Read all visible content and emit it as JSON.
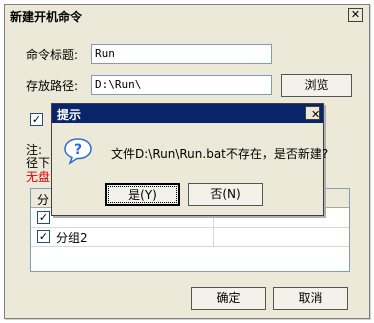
{
  "window": {
    "title": "新建开机命令"
  },
  "form": {
    "title_label": "命令标题:",
    "title_value": "Run",
    "path_label": "存放路径:",
    "path_value": "D:\\Run\\",
    "browse_label": "浏览",
    "note_visible_1": "注:",
    "note_visible_2": "径下",
    "warning_visible": "无盘"
  },
  "group_list": {
    "header_visible": "分",
    "rows": [
      {
        "label": "",
        "checked": true
      },
      {
        "label": "分组2",
        "checked": true
      }
    ]
  },
  "buttons": {
    "ok": "确定",
    "cancel": "取消"
  },
  "dialog": {
    "title": "提示",
    "message": "文件D:\\Run\\Run.bat不存在，是否新建?",
    "yes": "是(Y)",
    "no": "否(N)"
  },
  "icons": {
    "question": "question-icon",
    "close": "close-icon",
    "check": "checkmark-icon"
  },
  "colors": {
    "dialog_title_bg": "#0a246a",
    "warning_text": "#e00000",
    "icon_blue": "#2a6ad6"
  }
}
